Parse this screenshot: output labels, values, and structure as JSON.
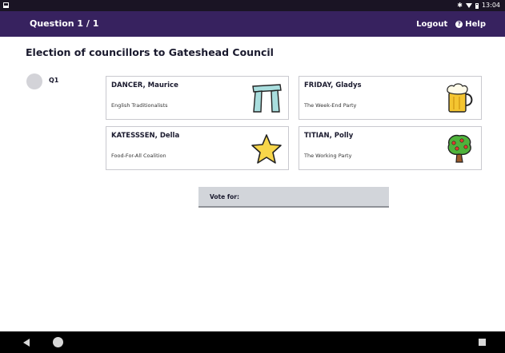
{
  "status_bar": {
    "time": "13:04",
    "icons": [
      "notification-icon",
      "bluetooth-icon",
      "wifi-icon",
      "battery-icon"
    ]
  },
  "app_bar": {
    "question_title": "Question 1 / 1",
    "logout_label": "Logout",
    "help_label": "Help",
    "help_glyph": "?"
  },
  "main": {
    "title": "Election of councillors to Gateshead Council",
    "question_label": "Q1",
    "candidates": [
      {
        "name": "DANCER, Maurice",
        "party": "English Traditionalists",
        "icon": "stonehenge-icon"
      },
      {
        "name": "FRIDAY, Gladys",
        "party": "The Week-End Party",
        "icon": "beer-mug-icon"
      },
      {
        "name": "KATESSSEN, Della",
        "party": "Food-For-All Coalition",
        "icon": "star-icon"
      },
      {
        "name": "TITIAN, Polly",
        "party": "The Working Party",
        "icon": "fruit-tree-icon"
      }
    ],
    "vote_label": "Vote for:"
  },
  "colors": {
    "app_bar": "#37225f",
    "status_bar": "#1a1424",
    "vote_box": "#d2d5da",
    "card_border": "#c9c9cf"
  }
}
